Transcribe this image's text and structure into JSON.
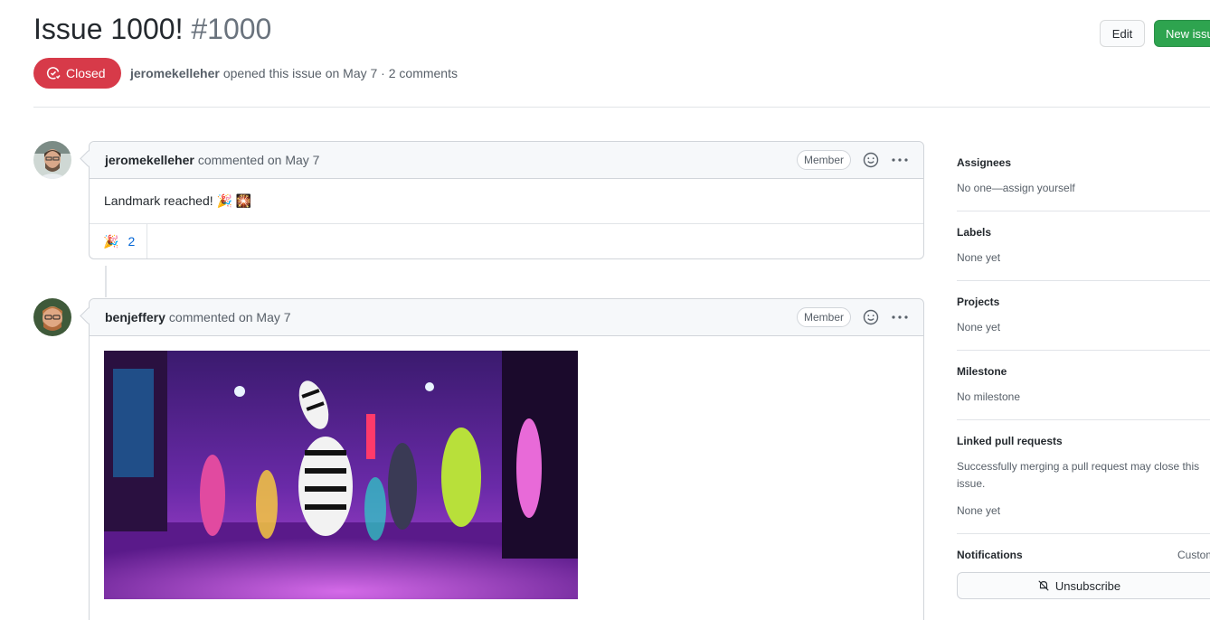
{
  "issue": {
    "title": "Issue 1000!",
    "number": "#1000",
    "state": "Closed",
    "author": "jeromekelleher",
    "meta_text": "opened this issue on May 7 · 2 comments"
  },
  "header_buttons": {
    "edit": "Edit",
    "new_issue": "New issue"
  },
  "comments": [
    {
      "author": "jeromekelleher",
      "action": "commented on May 7",
      "badge": "Member",
      "body": "Landmark reached! 🎉 🎇",
      "reaction_emoji": "🎉",
      "reaction_count": "2"
    },
    {
      "author": "benjeffery",
      "action": "commented on May 7",
      "badge": "Member"
    }
  ],
  "sidebar": {
    "assignees": {
      "title": "Assignees",
      "value": "No one—assign yourself"
    },
    "labels": {
      "title": "Labels",
      "value": "None yet"
    },
    "projects": {
      "title": "Projects",
      "value": "None yet"
    },
    "milestone": {
      "title": "Milestone",
      "value": "No milestone"
    },
    "linked_prs": {
      "title": "Linked pull requests",
      "description": "Successfully merging a pull request may close this issue.",
      "value": "None yet"
    },
    "notifications": {
      "title": "Notifications",
      "custom": "Customize",
      "unsubscribe": "Unsubscribe"
    }
  },
  "colors": {
    "closed": "#d73a49",
    "primary_button": "#2ea44f",
    "link": "#0366d6"
  }
}
